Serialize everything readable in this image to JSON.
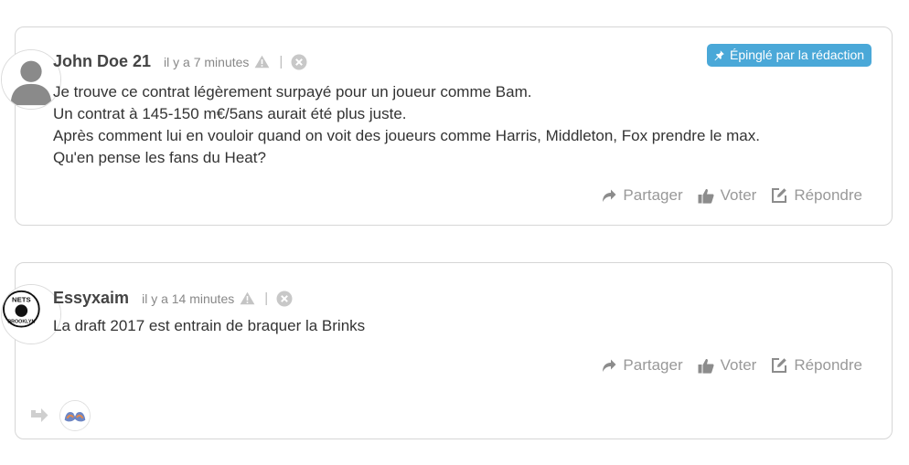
{
  "comments": [
    {
      "pinned_label": "Épinglé par la rédaction",
      "author": "John Doe 21",
      "time": "il y a 7 minutes",
      "separator": "|",
      "lines": [
        "Je trouve ce contrat légèrement surpayé pour un joueur comme Bam.",
        "Un contrat à 145-150 m€/5ans aurait été plus juste.",
        "Après comment lui en vouloir quand on voit des joueurs comme Harris, Middleton, Fox prendre le max.",
        "Qu'en pense les fans du Heat?"
      ],
      "actions": {
        "share": "Partager",
        "vote": "Voter",
        "reply": "Répondre"
      }
    },
    {
      "author": "Essyxaim",
      "time": "il y a 14 minutes",
      "separator": "|",
      "lines": [
        "La draft 2017 est entrain de braquer la Brinks"
      ],
      "actions": {
        "share": "Partager",
        "vote": "Voter",
        "reply": "Répondre"
      },
      "avatar_text": {
        "top": "NETS",
        "bottom": "BROOKLYN"
      }
    }
  ],
  "colors": {
    "badge": "#4aa8d8",
    "border": "#d6d6d6",
    "muted": "#999999",
    "text": "#333333"
  },
  "icons": {
    "pin": "pin-icon",
    "warning": "warning-icon",
    "close": "close-circle-icon",
    "share": "share-arrow-icon",
    "vote": "thumbs-up-icon",
    "reply": "edit-icon",
    "reply_thread": "reply-arrow-icon"
  }
}
